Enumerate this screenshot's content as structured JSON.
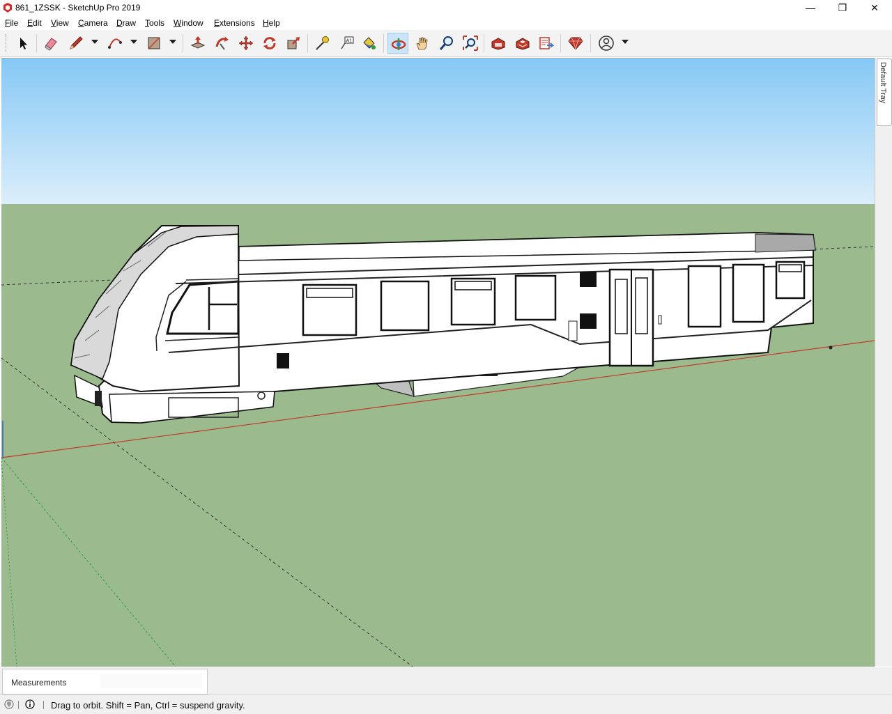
{
  "window": {
    "title": "861_1ZSSK - SketchUp Pro 2019",
    "minimize_glyph": "—",
    "maximize_glyph": "❐",
    "close_glyph": "✕"
  },
  "menu": {
    "items": [
      {
        "label": "File",
        "first": "F",
        "rest": "ile"
      },
      {
        "label": "Edit",
        "first": "E",
        "rest": "dit"
      },
      {
        "label": "View",
        "first": "V",
        "rest": "iew"
      },
      {
        "label": "Camera",
        "first": "C",
        "rest": "amera"
      },
      {
        "label": "Draw",
        "first": "D",
        "rest": "raw"
      },
      {
        "label": "Tools",
        "first": "T",
        "rest": "ools"
      },
      {
        "label": "Window",
        "first": "W",
        "rest": "indow"
      },
      {
        "label": "Extensions",
        "first": "E",
        "rest": "xtensions"
      },
      {
        "label": "Help",
        "first": "H",
        "rest": "elp"
      }
    ]
  },
  "toolbar": {
    "tools": [
      "select",
      "eraser",
      "line",
      "arc",
      "rectangle",
      "push-pull",
      "follow-me",
      "move",
      "rotate",
      "scale",
      "tape-measure",
      "text",
      "paint-bucket",
      "orbit",
      "pan",
      "zoom",
      "zoom-extents",
      "3d-warehouse",
      "extension-warehouse",
      "layout",
      "extension-manager",
      "account"
    ],
    "active_tool": "orbit"
  },
  "tray": {
    "tab_label": "Default Tray"
  },
  "measurements": {
    "label": "Measurements",
    "value": ""
  },
  "status": {
    "hint": "Drag to orbit. Shift = Pan, Ctrl = suspend gravity."
  },
  "scene": {
    "sky_top_color": "#86c8f5",
    "sky_bottom_color": "#dbeefb",
    "ground_color": "#9bbb8f",
    "model_fill": "#ffffff",
    "model_roof_color": "#d9d9d9",
    "red_axis_color": "#c0392b",
    "green_axis_color": "#2e9b3a"
  }
}
